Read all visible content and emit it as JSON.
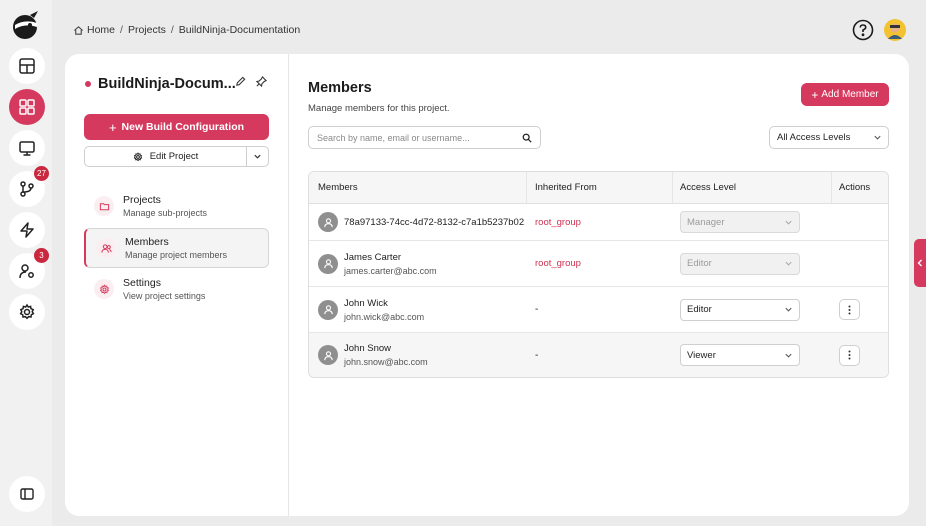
{
  "breadcrumb": {
    "items": [
      "Home",
      "Projects",
      "BuildNinja-Documentation"
    ],
    "separator": "/"
  },
  "rail": {
    "items": [
      {
        "name": "dashboard",
        "icon": "table-layout-icon",
        "active": false
      },
      {
        "name": "projects",
        "icon": "grid-icon",
        "active": true
      },
      {
        "name": "agents",
        "icon": "monitor-icon",
        "active": false
      },
      {
        "name": "builds",
        "icon": "branch-icon",
        "active": false,
        "badge": "27"
      },
      {
        "name": "pipelines",
        "icon": "lightning-icon",
        "active": false
      },
      {
        "name": "users",
        "icon": "user-settings-icon",
        "active": false,
        "badge": "3"
      },
      {
        "name": "settings",
        "icon": "gear-icon",
        "active": false
      }
    ],
    "bottom_icon": "sidebar-toggle-icon"
  },
  "project": {
    "title": "BuildNinja-Docum...",
    "new_build_label": "New Build Configuration",
    "edit_label": "Edit Project",
    "nav": [
      {
        "title": "Projects",
        "subtitle": "Manage sub-projects",
        "icon": "folder-icon",
        "active": false
      },
      {
        "title": "Members",
        "subtitle": "Manage project members",
        "icon": "users-icon",
        "active": true
      },
      {
        "title": "Settings",
        "subtitle": "View project settings",
        "icon": "gear-icon",
        "active": false
      }
    ]
  },
  "members_page": {
    "title": "Members",
    "subtitle": "Manage members for this project.",
    "add_label": "Add Member",
    "search_placeholder": "Search by name, email or username...",
    "filter_value": "All Access Levels",
    "columns": [
      "Members",
      "Inherited From",
      "Access Level",
      "Actions"
    ],
    "rows": [
      {
        "name": "78a97133-74cc-4d72-8132-c7a1b5237b02",
        "email": "",
        "inherited": "root_group",
        "access": "Manager",
        "editable": false
      },
      {
        "name": "James Carter",
        "email": "james.carter@abc.com",
        "inherited": "root_group",
        "access": "Editor",
        "editable": false
      },
      {
        "name": "John Wick",
        "email": "john.wick@abc.com",
        "inherited": "-",
        "access": "Editor",
        "editable": true
      },
      {
        "name": "John Snow",
        "email": "john.snow@abc.com",
        "inherited": "-",
        "access": "Viewer",
        "editable": true
      }
    ]
  },
  "colors": {
    "accent": "#d53a5e",
    "inherited_text": "#d0314f"
  }
}
